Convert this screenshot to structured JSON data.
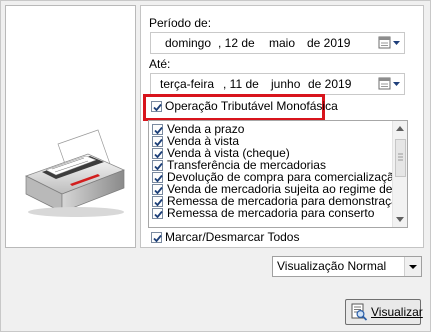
{
  "periodo": {
    "label": "Período de:",
    "weekday": "domingo",
    "day": ", 12 de",
    "month": "maio",
    "year": "de 2019"
  },
  "ate": {
    "label": "Até:",
    "weekday": "terça-feira",
    "day": ", 11 de",
    "month": "junho",
    "year": "de 2019"
  },
  "monofasica": {
    "label": "Operação Tributável Monofásica",
    "checked": true
  },
  "operations": [
    {
      "label": "Venda a prazo",
      "checked": true
    },
    {
      "label": "Venda à vista",
      "checked": true
    },
    {
      "label": "Venda à vista (cheque)",
      "checked": true
    },
    {
      "label": "Transferência de mercadorias",
      "checked": true
    },
    {
      "label": "Devolução de compra para comercialização",
      "checked": true
    },
    {
      "label": "Venda de mercadoria sujeita ao regime de ST",
      "checked": true
    },
    {
      "label": "Remessa de mercadoria para demonstração",
      "checked": true
    },
    {
      "label": "Remessa de mercadoria para conserto",
      "checked": true
    }
  ],
  "toggle_all": {
    "label": "Marcar/Desmarcar Todos",
    "checked": true
  },
  "mode_select": {
    "value": "Visualização Normal"
  },
  "visualizar_button": {
    "label": "Visualizar"
  },
  "icons": {
    "image": "printer-icon",
    "date_picker": "calendar-icon",
    "dropdown": "chevron-down-icon",
    "action": "preview-document-icon"
  },
  "colors": {
    "highlight_border": "#d8141c",
    "checkmark": "#1c3f78"
  }
}
